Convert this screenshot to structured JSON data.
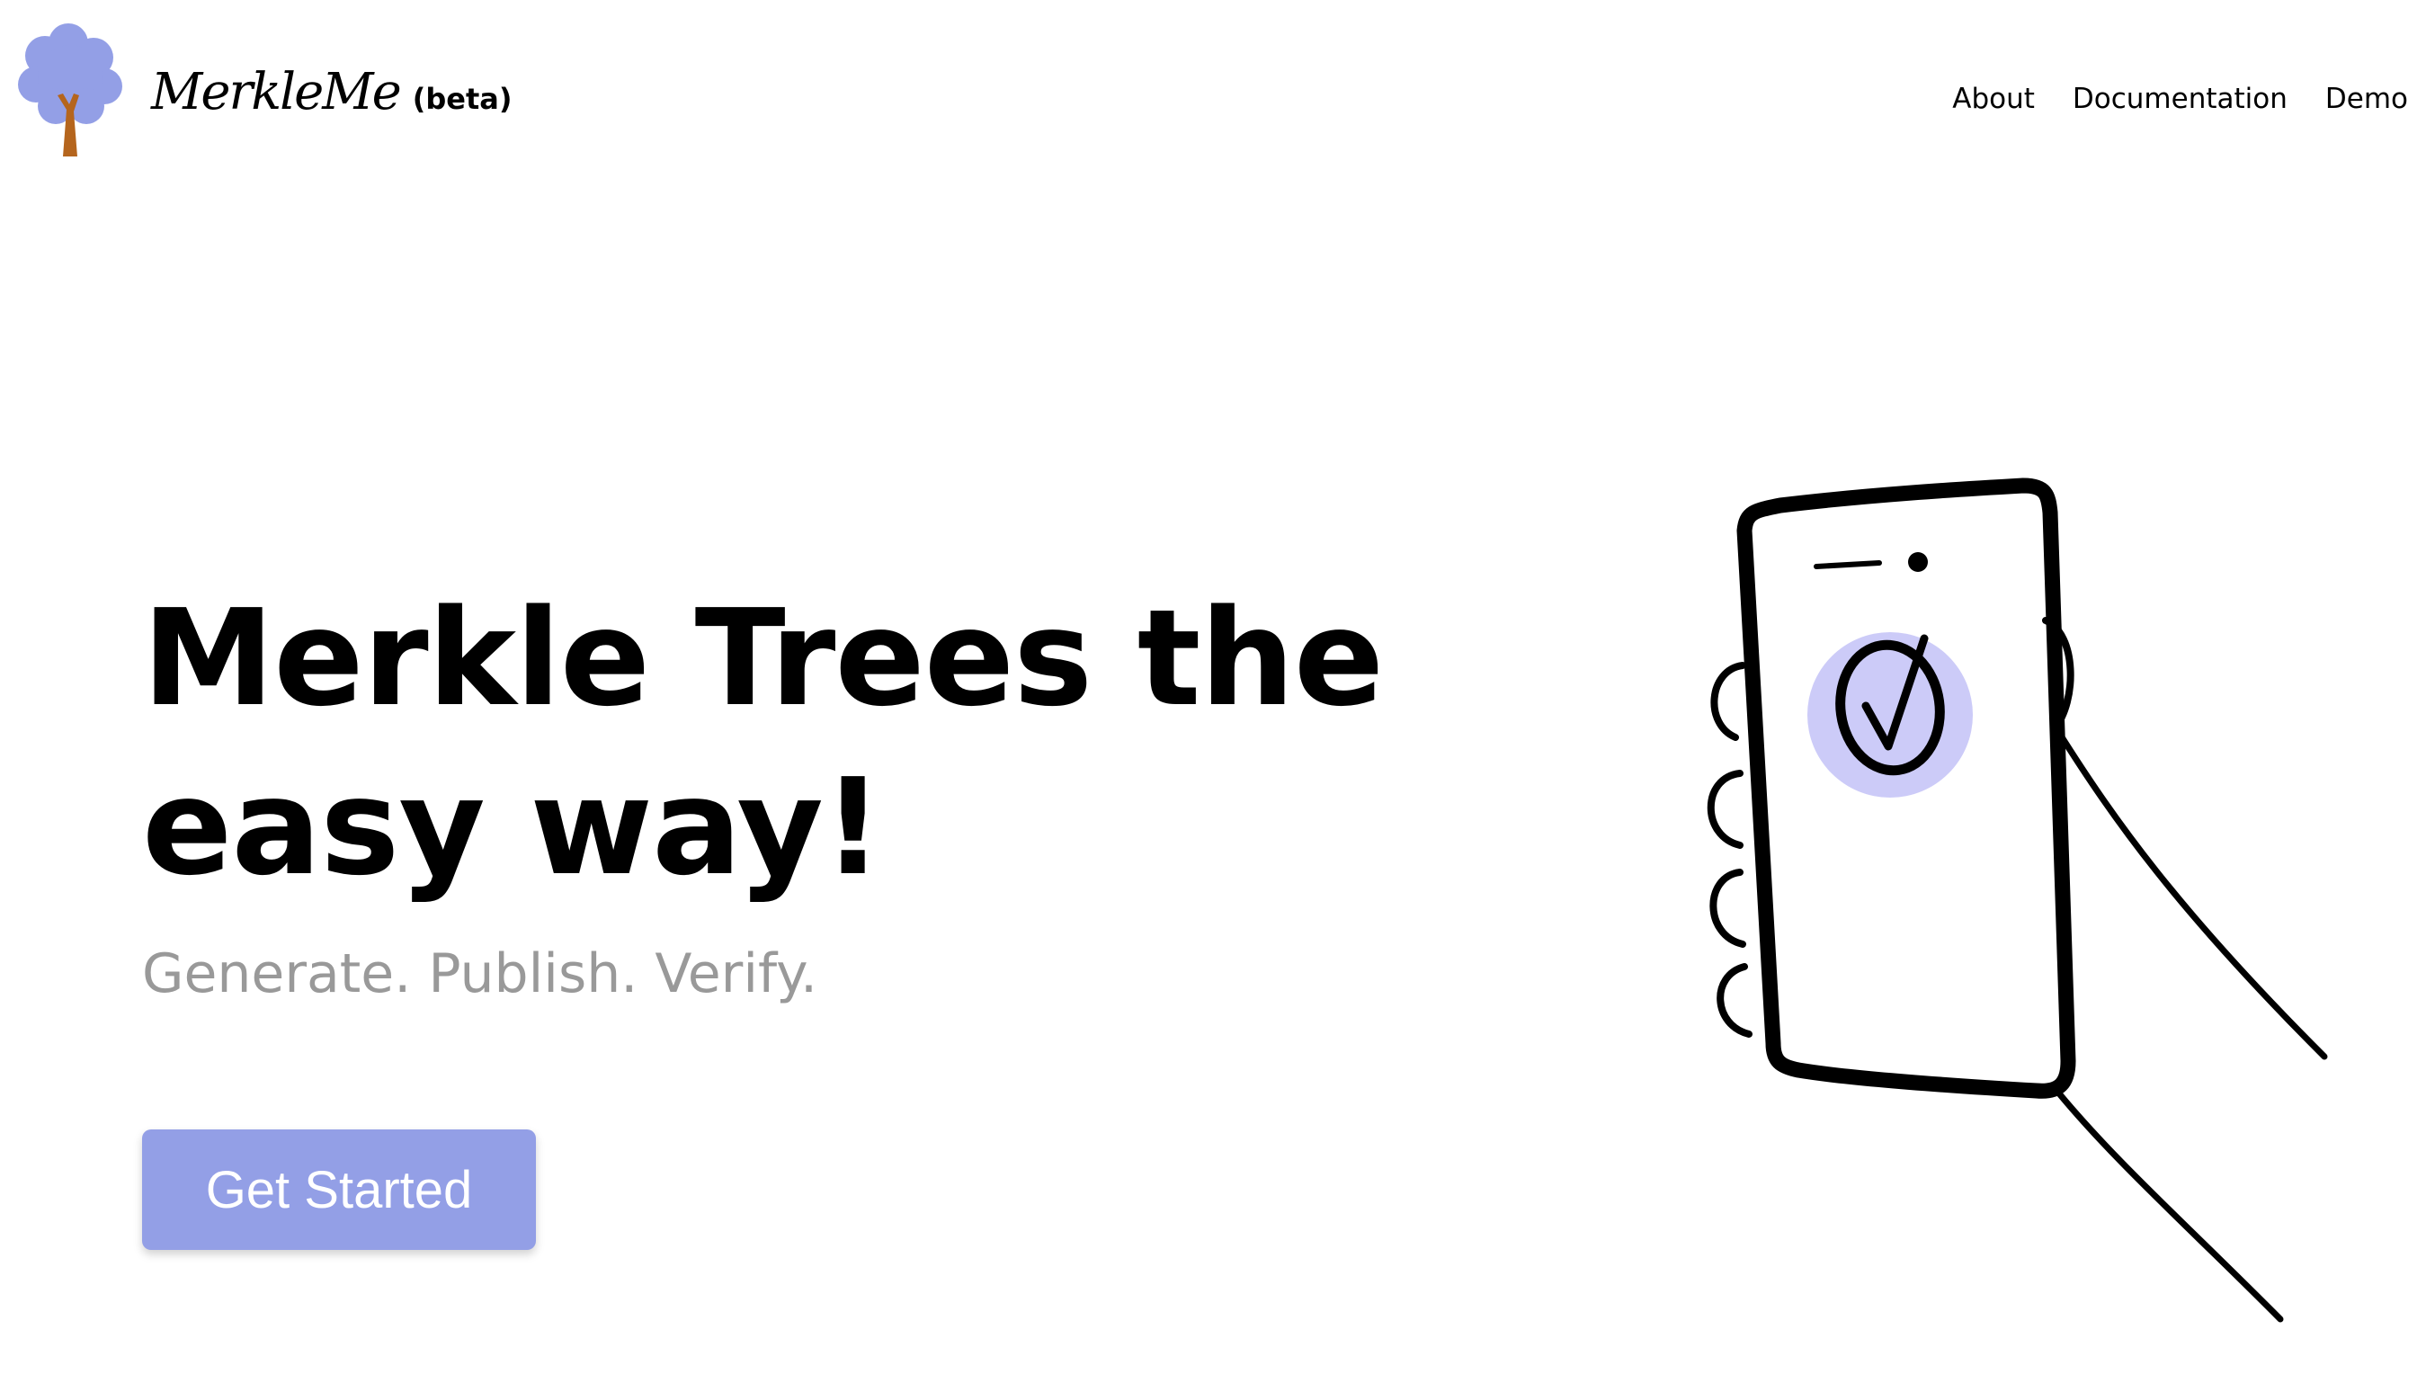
{
  "header": {
    "brand_name": "MerkleMe",
    "brand_tag": "(beta)",
    "logo_icon": "tree-icon",
    "nav": [
      {
        "label": "About"
      },
      {
        "label": "Documentation"
      },
      {
        "label": "Demo"
      }
    ]
  },
  "hero": {
    "title": "Merkle Trees the easy way!",
    "subtitle": "Generate. Publish. Verify.",
    "cta_label": "Get Started",
    "illustration_icon": "hand-holding-phone-checkmark-icon"
  },
  "colors": {
    "accent": "#939fe6",
    "accent_light": "#cccbf8",
    "subtitle_gray": "#999999",
    "tree_trunk": "#b5651d"
  }
}
